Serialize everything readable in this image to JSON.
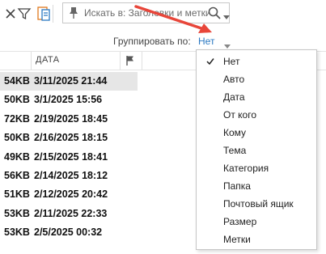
{
  "toolbar": {
    "icons": [
      "close-icon",
      "filter-icon",
      "categories-icon",
      "pin-icon",
      "search-icon",
      "chevron-down-icon"
    ],
    "search_placeholder": "Искать в: Заголовки и метки"
  },
  "group": {
    "label": "Группировать по:",
    "value": "Нет"
  },
  "header": {
    "date": "ДАТА"
  },
  "rows": [
    {
      "size": "54KB",
      "date": "3/11/2025 21:44"
    },
    {
      "size": "50KB",
      "date": "3/1/2025 15:56"
    },
    {
      "size": "72KB",
      "date": "2/19/2025 18:45"
    },
    {
      "size": "50KB",
      "date": "2/16/2025 18:15"
    },
    {
      "size": "49KB",
      "date": "2/15/2025 18:41"
    },
    {
      "size": "56KB",
      "date": "2/14/2025 18:12"
    },
    {
      "size": "51KB",
      "date": "2/12/2025 20:42"
    },
    {
      "size": "53KB",
      "date": "2/11/2025 22:33"
    },
    {
      "size": "53KB",
      "date": "2/5/2025 00:32"
    },
    {
      "size": "",
      "date": ""
    }
  ],
  "menu": {
    "items": [
      "Нет",
      "Авто",
      "Дата",
      "От кого",
      "Кому",
      "Тема",
      "Категория",
      "Папка",
      "Почтовый ящик",
      "Размер",
      "Метки"
    ],
    "checked_index": 0
  },
  "colors": {
    "accent": "#2b79c2",
    "arrow": "#e8463a",
    "selected_row": "#e6e6e6"
  }
}
